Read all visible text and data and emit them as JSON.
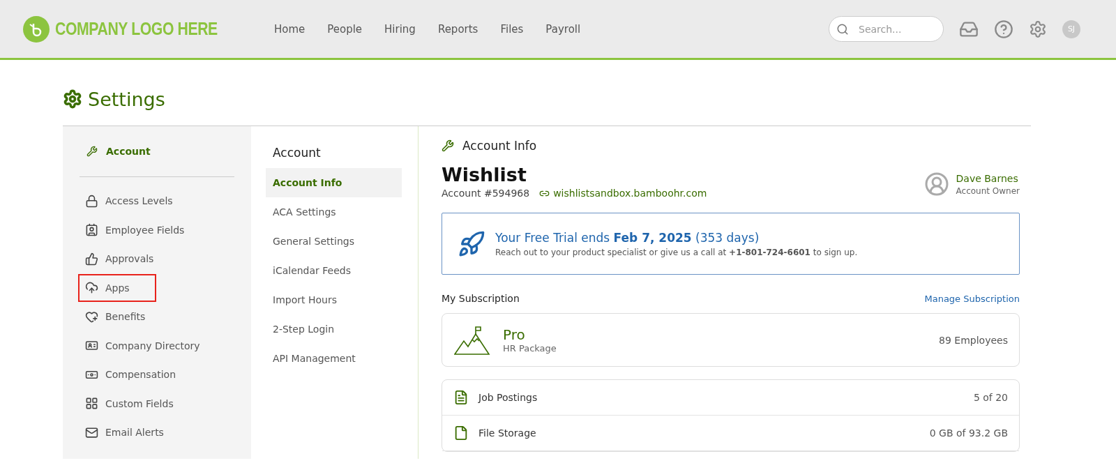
{
  "header": {
    "logo_text": "COMPANY LOGO HERE",
    "nav": [
      {
        "label": "Home",
        "selected": false
      },
      {
        "label": "People",
        "selected": false
      },
      {
        "label": "Hiring",
        "selected": false
      },
      {
        "label": "Reports",
        "selected": false
      },
      {
        "label": "Files",
        "selected": false
      },
      {
        "label": "Payroll",
        "selected": false
      }
    ],
    "search": {
      "placeholder": "Search..."
    },
    "avatar_initials": "SJ"
  },
  "page_title": "Settings",
  "sidebar": {
    "top_item": {
      "label": "Account",
      "selected": true
    },
    "items": [
      {
        "label": "Access Levels",
        "highlighted": false
      },
      {
        "label": "Employee Fields",
        "highlighted": false
      },
      {
        "label": "Approvals",
        "highlighted": false
      },
      {
        "label": "Apps",
        "highlighted": true
      },
      {
        "label": "Benefits",
        "highlighted": false
      },
      {
        "label": "Company Directory",
        "highlighted": false
      },
      {
        "label": "Compensation",
        "highlighted": false
      },
      {
        "label": "Custom Fields",
        "highlighted": false
      },
      {
        "label": "Email Alerts",
        "highlighted": false
      }
    ]
  },
  "subnav": {
    "heading": "Account",
    "items": [
      {
        "label": "Account Info",
        "selected": true
      },
      {
        "label": "ACA Settings",
        "selected": false
      },
      {
        "label": "General Settings",
        "selected": false
      },
      {
        "label": "iCalendar Feeds",
        "selected": false
      },
      {
        "label": "Import Hours",
        "selected": false
      },
      {
        "label": "2-Step Login",
        "selected": false
      },
      {
        "label": "API Management",
        "selected": false
      }
    ]
  },
  "main": {
    "section_title": "Account Info",
    "company": "Wishlist",
    "account_number": "Account #594968",
    "domain": "wishlistsandbox.bamboohr.com",
    "owner": {
      "name": "Dave Barnes",
      "role": "Account Owner"
    },
    "trial": {
      "headline": "Your Free Trial ends **Feb 7, 2025** (353 days)",
      "text": "Reach out to your product specialist or give us a call at **+1-801-724-6601** to sign up."
    },
    "subscription": {
      "title": "My Subscription",
      "manage_link": "Manage Subscription",
      "plan": "Pro",
      "package": "HR Package",
      "employees": "89 Employees"
    },
    "usage": [
      {
        "label": "Job Postings",
        "value": "5 of 20"
      },
      {
        "label": "File Storage",
        "value": "0 GB of 93.2 GB"
      }
    ]
  }
}
